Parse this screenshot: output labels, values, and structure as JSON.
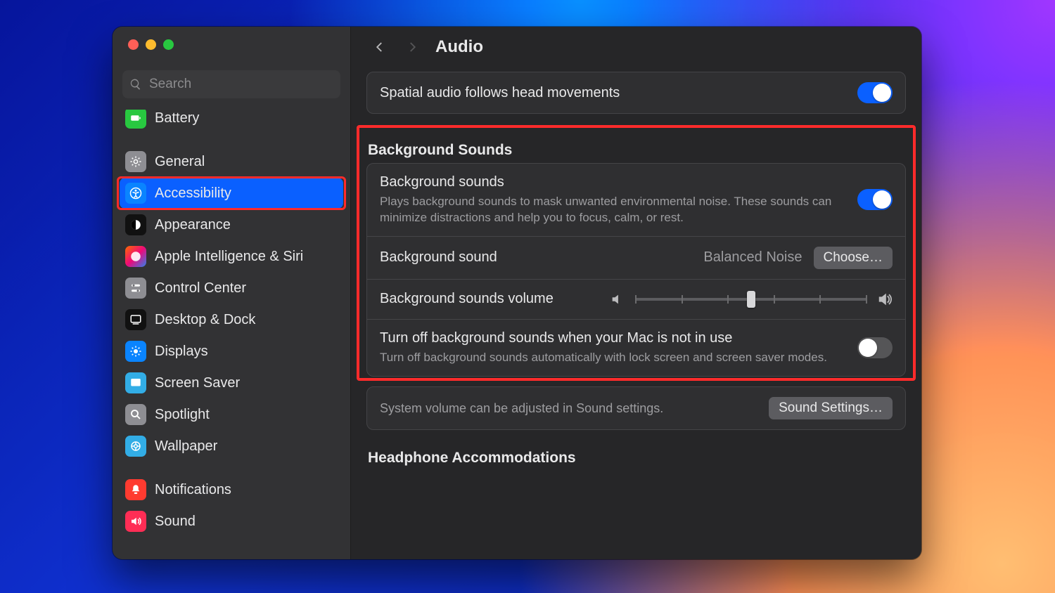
{
  "search": {
    "placeholder": "Search"
  },
  "sidebar": {
    "items": [
      {
        "id": "battery",
        "label": "Battery",
        "icon": "battery",
        "color": "#28c840"
      },
      {
        "id": "gap"
      },
      {
        "id": "general",
        "label": "General",
        "icon": "gear",
        "color": "#8e8e93"
      },
      {
        "id": "accessibility",
        "label": "Accessibility",
        "icon": "accessibility",
        "color": "#0a84ff",
        "selected": true,
        "highlight": true
      },
      {
        "id": "appearance",
        "label": "Appearance",
        "icon": "appearance",
        "color": "#111111"
      },
      {
        "id": "ai-siri",
        "label": "Apple Intelligence & Siri",
        "icon": "siri",
        "color": "linear"
      },
      {
        "id": "control-center",
        "label": "Control Center",
        "icon": "control",
        "color": "#8e8e93"
      },
      {
        "id": "desktop-dock",
        "label": "Desktop & Dock",
        "icon": "dock",
        "color": "#111111"
      },
      {
        "id": "displays",
        "label": "Displays",
        "icon": "displays",
        "color": "#0a84ff"
      },
      {
        "id": "screen-saver",
        "label": "Screen Saver",
        "icon": "screensaver",
        "color": "#32ade6"
      },
      {
        "id": "spotlight",
        "label": "Spotlight",
        "icon": "search",
        "color": "#8e8e93"
      },
      {
        "id": "wallpaper",
        "label": "Wallpaper",
        "icon": "wallpaper",
        "color": "#32ade6"
      },
      {
        "id": "gap2"
      },
      {
        "id": "notifications",
        "label": "Notifications",
        "icon": "bell",
        "color": "#ff3b30"
      },
      {
        "id": "sound",
        "label": "Sound",
        "icon": "sound",
        "color": "#ff2d55"
      }
    ]
  },
  "header": {
    "title": "Audio"
  },
  "main": {
    "spatialRow": {
      "label": "Spatial audio follows head movements",
      "on": true
    },
    "bgSection": {
      "title": "Background Sounds",
      "enableRow": {
        "label": "Background sounds",
        "sub": "Plays background sounds to mask unwanted environmental noise. These sounds can minimize distractions and help you to focus, calm, or rest.",
        "on": true
      },
      "soundRow": {
        "label": "Background sound",
        "value": "Balanced Noise",
        "button": "Choose…"
      },
      "volumeRow": {
        "label": "Background sounds volume",
        "value": 0.5
      },
      "idleRow": {
        "label": "Turn off background sounds when your Mac is not in use",
        "sub": "Turn off background sounds automatically with lock screen and screen saver modes.",
        "on": false
      }
    },
    "sysRow": {
      "label": "System volume can be adjusted in Sound settings.",
      "button": "Sound Settings…"
    },
    "headphoneSection": {
      "title": "Headphone Accommodations"
    }
  }
}
